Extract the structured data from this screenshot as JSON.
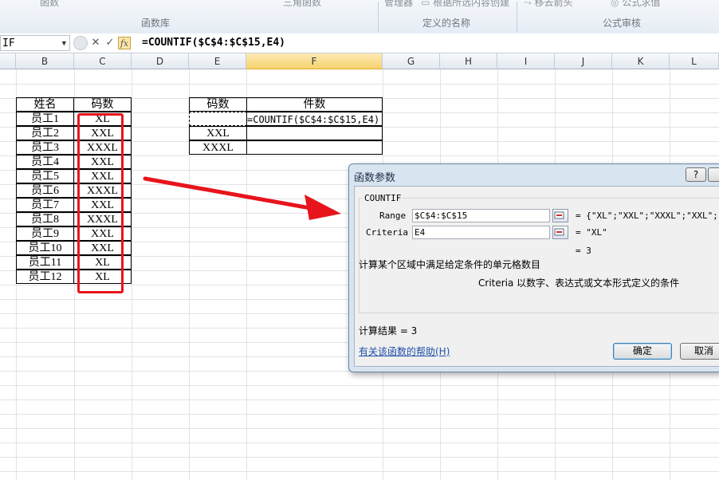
{
  "ribbon": {
    "top_items": [
      "函数",
      "三角函数",
      "管理器",
      "根据所选内容创建",
      "移去箭头",
      "公式求值"
    ],
    "groups": [
      "函数库",
      "定义的名称",
      "公式审核"
    ]
  },
  "formula_bar": {
    "name_box": "IF",
    "cancel_icon": "✕",
    "enter_icon": "✓",
    "fx_label": "fx",
    "formula": "=COUNTIF($C$4:$C$15,E4)"
  },
  "columns": [
    "B",
    "C",
    "D",
    "E",
    "F",
    "G",
    "H",
    "I",
    "J",
    "K",
    "L"
  ],
  "selected_column": "F",
  "table1": {
    "headers": [
      "姓名",
      "码数"
    ],
    "rows": [
      [
        "员工1",
        "XL"
      ],
      [
        "员工2",
        "XXL"
      ],
      [
        "员工3",
        "XXXL"
      ],
      [
        "员工4",
        "XXL"
      ],
      [
        "员工5",
        "XXL"
      ],
      [
        "员工6",
        "XXXL"
      ],
      [
        "员工7",
        "XXL"
      ],
      [
        "员工8",
        "XXXL"
      ],
      [
        "员工9",
        "XXL"
      ],
      [
        "员工10",
        "XXL"
      ],
      [
        "员工11",
        "XL"
      ],
      [
        "员工12",
        "XL"
      ]
    ]
  },
  "table2": {
    "headers": [
      "码数",
      "件数"
    ],
    "rows": [
      [
        "",
        "=COUNTIF($C$4:$C$15,E4)"
      ],
      [
        "XXL",
        ""
      ],
      [
        "XXXL",
        ""
      ]
    ]
  },
  "dialog": {
    "title": "函数参数",
    "help_btn": "?",
    "function_name": "COUNTIF",
    "args": [
      {
        "label": "Range",
        "value": "$C$4:$C$15",
        "result": "= {\"XL\";\"XXL\";\"XXXL\";\"XXL\";\"X"
      },
      {
        "label": "Criteria",
        "value": "E4",
        "result": "= \"XL\""
      }
    ],
    "result_preview": "= 3",
    "description": "计算某个区域中满足给定条件的单元格数目",
    "arg_description": "Criteria  以数字、表达式或文本形式定义的条件",
    "calc_result": "计算结果 = 3",
    "help_link": "有关该函数的帮助(H)",
    "ok_label": "确定",
    "cancel_label": "取消"
  },
  "colors": {
    "highlight_box": "#e8141c",
    "arrow": "#e8141c",
    "selected_column": "#f6d36e"
  }
}
